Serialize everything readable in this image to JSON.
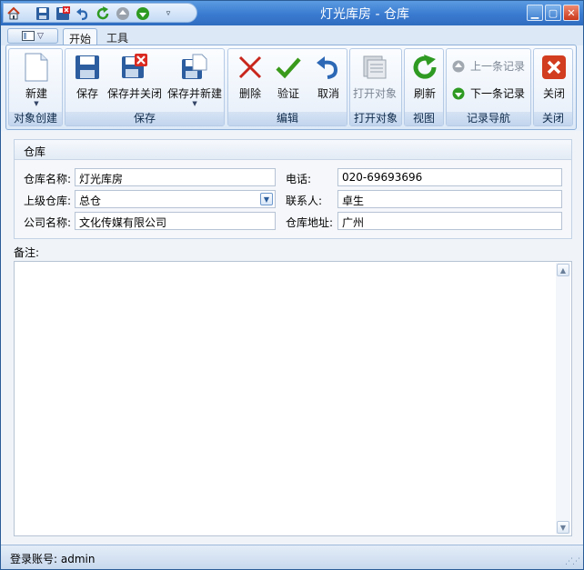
{
  "window": {
    "title": "灯光库房 - 仓库"
  },
  "tabs": [
    {
      "label": "开始"
    },
    {
      "label": "工具"
    }
  ],
  "ribbon": {
    "groups": {
      "create": "对象创建",
      "save": "保存",
      "edit": "编辑",
      "open": "打开对象",
      "view": "视图",
      "nav": "记录导航",
      "close": "关闭"
    },
    "buttons": {
      "new": "新建",
      "save": "保存",
      "save_close": "保存并关闭",
      "save_new": "保存并新建",
      "delete": "删除",
      "validate": "验证",
      "cancel": "取消",
      "open_object": "打开对象",
      "refresh": "刷新",
      "prev_record": "上一条记录",
      "next_record": "下一条记录",
      "close": "关闭"
    }
  },
  "form": {
    "section_title": "仓库",
    "fields": {
      "warehouse_name": {
        "label": "仓库名称:",
        "value": "灯光库房"
      },
      "phone": {
        "label": "电话:",
        "value": "020-69693696"
      },
      "parent_warehouse": {
        "label": "上级仓库:",
        "value": "总仓"
      },
      "contact": {
        "label": "联系人:",
        "value": "卓生"
      },
      "company_name": {
        "label": "公司名称:",
        "value": "文化传媒有限公司"
      },
      "warehouse_address": {
        "label": "仓库地址:",
        "value": "广州"
      }
    },
    "remark_label": "备注:",
    "remark_value": ""
  },
  "status": {
    "login_account": "登录账号: admin"
  },
  "colors": {
    "titlebar": "#3a7bd0",
    "ribbon_bg": "#dde9f7",
    "close_red": "#d23c1f",
    "check_green": "#3c9a1d"
  }
}
